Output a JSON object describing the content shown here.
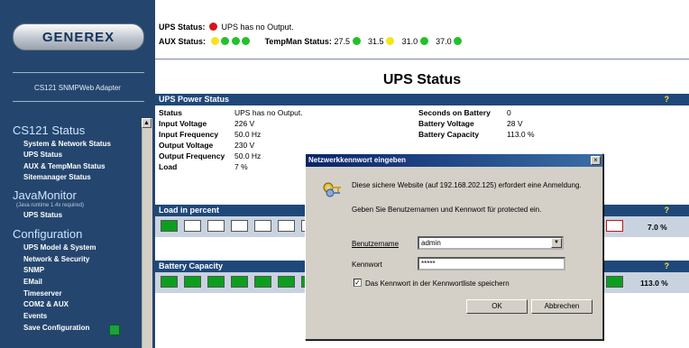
{
  "brand": {
    "logo_text": "GENEREX",
    "subtitle": "CS121 SNMPWeb Adapter"
  },
  "sidebar": {
    "sections": [
      {
        "title": "CS121 Status",
        "items": [
          "System & Network Status",
          "UPS Status",
          "AUX & TempMan Status",
          "Sitemanager Status"
        ]
      },
      {
        "title": "JavaMonitor",
        "note": "(Java runtime 1.4x required)",
        "items": [
          "UPS Status"
        ]
      },
      {
        "title": "Configuration",
        "items": [
          "UPS Model & System",
          "Network & Security",
          "SNMP",
          "EMail",
          "Timeserver",
          "COM2 & AUX",
          "Events",
          "Save Configuration"
        ]
      }
    ]
  },
  "header": {
    "ups_status_label": "UPS Status:",
    "ups_status_value": "UPS has no Output.",
    "aux_status_label": "AUX Status:",
    "tempman_label": "TempMan Status:",
    "temps": [
      "27.5",
      "31.5",
      "31.0",
      "37.0"
    ],
    "colors": {
      "red": "#d4161a",
      "yellow": "#f4e51c",
      "green": "#22c12a"
    }
  },
  "page_title": "UPS Status",
  "power_panel": {
    "title": "UPS Power Status",
    "help": "?",
    "left": [
      {
        "label": "Status",
        "value": "UPS has no Output."
      },
      {
        "label": "Input Voltage",
        "value": "226 V"
      },
      {
        "label": "Input Frequency",
        "value": "50.0 Hz"
      },
      {
        "label": "Output Voltage",
        "value": "230 V"
      },
      {
        "label": "Output Frequency",
        "value": "50.0 Hz"
      },
      {
        "label": "Load",
        "value": "7 %"
      }
    ],
    "right": [
      {
        "label": "Seconds on Battery",
        "value": "0"
      },
      {
        "label": "Battery Voltage",
        "value": "28 V"
      },
      {
        "label": "Battery Capacity",
        "value": "113.0 %"
      }
    ]
  },
  "load_panel": {
    "title": "Load in percent",
    "help": "?",
    "value": "7.0 %",
    "level": 0.07
  },
  "battery_panel": {
    "title": "Battery Capacity",
    "help": "?",
    "value": "113.0 %",
    "level": 1.0
  },
  "dialog": {
    "title": "Netzwerkkennwort eingeben",
    "close": "×",
    "message": "Diese sichere Website (auf 192.168.202.125) erfordert eine Anmeldung.",
    "prompt": "Geben Sie Benutzernamen und Kennwort für protected ein.",
    "username_label": "Benutzername",
    "username_value": "admin",
    "password_label": "Kennwort",
    "password_value": "*****",
    "remember_label": "Das Kennwort in der Kennwortliste speichern",
    "remember_checked": true,
    "ok_label": "OK",
    "cancel_label": "Abbrechen"
  }
}
